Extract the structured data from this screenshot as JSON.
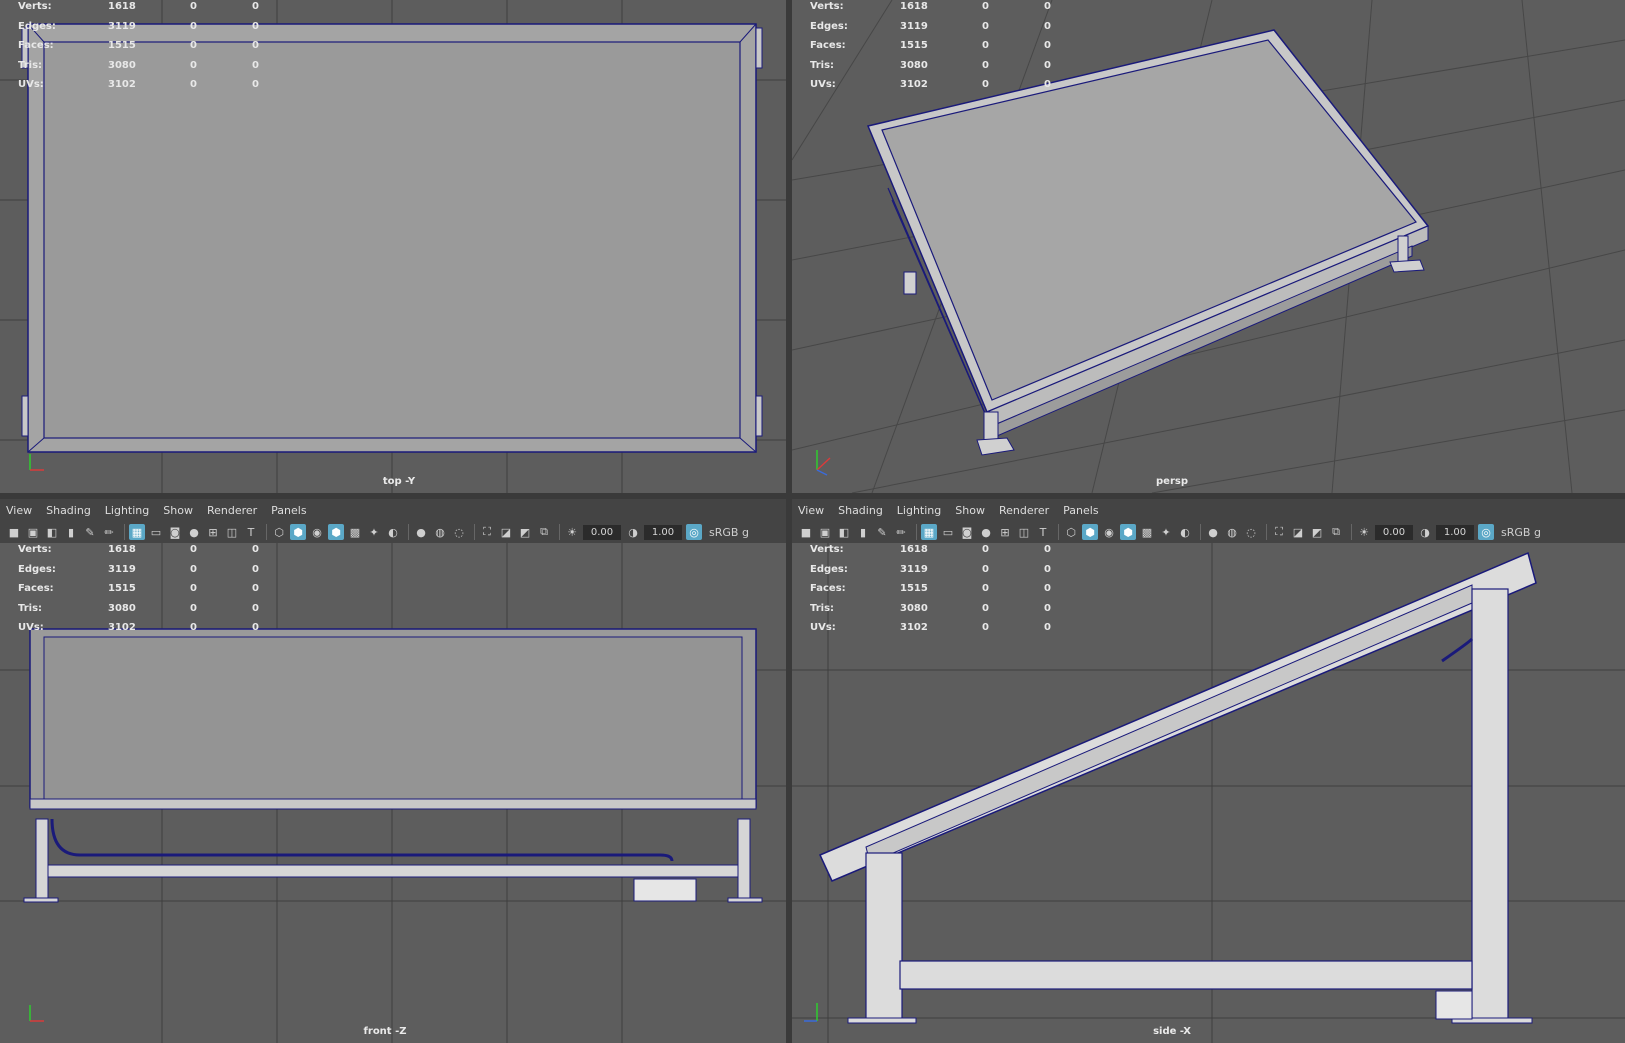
{
  "stats": {
    "labels": [
      "Verts:",
      "Edges:",
      "Faces:",
      "Tris:",
      "UVs:"
    ],
    "rows": [
      {
        "label": "Verts:",
        "total": "1618",
        "sel": "0",
        "comp": "0"
      },
      {
        "label": "Edges:",
        "total": "3119",
        "sel": "0",
        "comp": "0"
      },
      {
        "label": "Faces:",
        "total": "1515",
        "sel": "0",
        "comp": "0"
      },
      {
        "label": "Tris:",
        "total": "3080",
        "sel": "0",
        "comp": "0"
      },
      {
        "label": "UVs:",
        "total": "3102",
        "sel": "0",
        "comp": "0"
      }
    ]
  },
  "viewports": {
    "top": {
      "camera": "top -Y"
    },
    "persp": {
      "camera": "persp"
    },
    "front": {
      "camera": "front -Z"
    },
    "side": {
      "camera": "side -X"
    }
  },
  "panel_menu": [
    "View",
    "Shading",
    "Lighting",
    "Show",
    "Renderer",
    "Panels"
  ],
  "toolbar": {
    "exposure": "0.00",
    "gamma": "1.00",
    "colorspace": "sRGB g"
  },
  "colors": {
    "viewport_bg": "#5d5d5d",
    "grid": "#3f3f3f",
    "wire": "#1a1a7a",
    "surface": "#9a9a9a",
    "metal": "#d8d8d8",
    "active_icon": "#5ba8c7"
  }
}
